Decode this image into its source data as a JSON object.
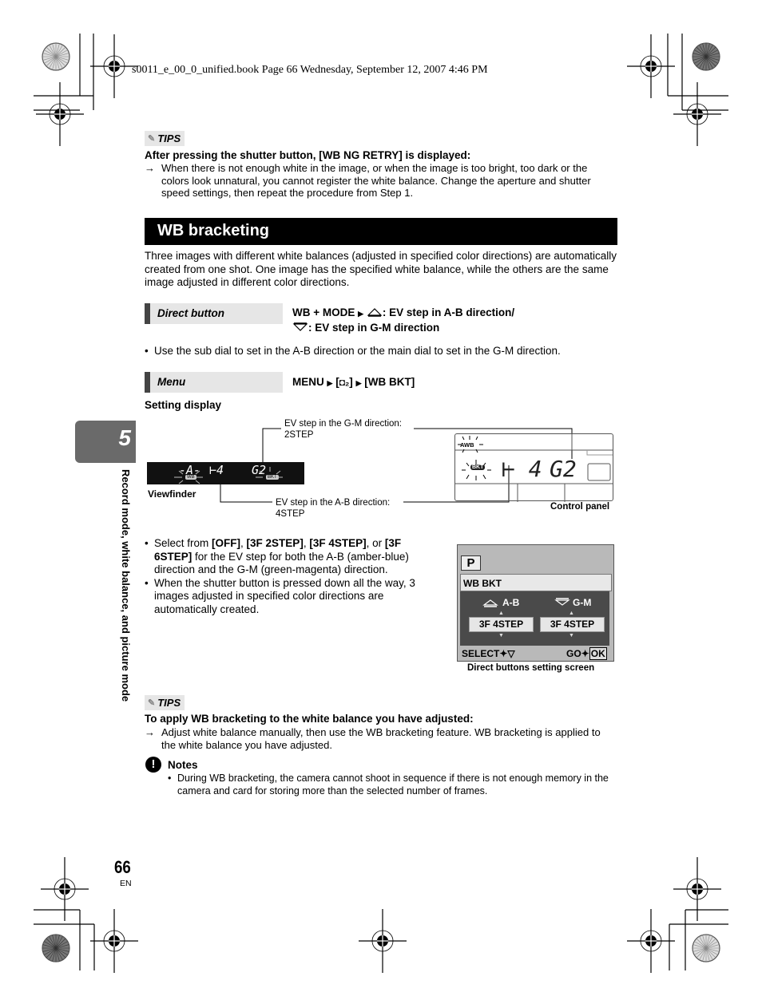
{
  "print_header": "s0011_e_00_0_unified.book  Page 66  Wednesday, September 12, 2007  4:46 PM",
  "tips1": {
    "badge": "TIPS",
    "icon": "memo-icon",
    "heading": "After pressing the shutter button, [WB NG RETRY] is displayed:",
    "arrow": "→",
    "text": "When there is not enough white in the image, or when the image is too bright, too dark or the colors look unnatural, you cannot register the white balance. Change the aperture and shutter speed settings, then repeat the procedure from Step 1."
  },
  "section": {
    "title": "WB bracketing",
    "intro": "Three images with different white balances (adjusted in specified color directions) are automatically created from one shot. One image has the specified white balance, while the others are the same image adjusted in different color directions."
  },
  "direct_button": {
    "label": "Direct button",
    "line1_prefix": "WB + MODE",
    "line1_rest": ": EV step in A-B direction/",
    "line2_rest": ": EV step in G-M direction",
    "tip": "Use the sub dial to set in the A-B direction or the main dial to set in the G-M direction."
  },
  "menu": {
    "label": "Menu",
    "path_a": "MENU",
    "path_b": "[",
    "path_b_icon": "camera2-icon",
    "path_b_end": "]",
    "path_c": "[WB BKT]"
  },
  "setting_display": {
    "heading": "Setting display",
    "callout_gm": "EV step in the G-M direction:",
    "callout_gm_value": "2STEP",
    "callout_ab": "EV step in the A-B direction:",
    "callout_ab_value": "4STEP",
    "viewfinder_label": "Viewfinder",
    "control_panel_label": "Control panel",
    "vf_wb": "-A-",
    "vf_ab": "⊢4",
    "vf_gm": "G2",
    "vf_wb_badge": "WB",
    "vf_bkt_badge": "BKT",
    "cp_awb": "AWB",
    "cp_bkt": "BKT",
    "cp_ab": "⊢ 4",
    "cp_gm": "G2"
  },
  "bullets": {
    "b1_pre": "Select from ",
    "b1_off": "[OFF]",
    "b1_c1": ", ",
    "b1_2": "[3F 2STEP]",
    "b1_c2": ", ",
    "b1_4": "[3F 4STEP]",
    "b1_or": ", or ",
    "b1_6": "[3F 6STEP]",
    "b1_post": " for the EV step for both the A-B (amber-blue) direction and the G-M (green-magenta) direction.",
    "b2": "When the shutter button is pressed down all the way, 3 images adjusted in specified color directions are automatically created."
  },
  "screen": {
    "mode": "P",
    "menu_title": "WB BKT",
    "ab_label": "A-B",
    "gm_label": "G-M",
    "ab_value": "3F 4STEP",
    "gm_value": "3F 4STEP",
    "select_label": "SELECT",
    "go_label": "GO",
    "ok_label": "OK",
    "caption": "Direct buttons setting screen"
  },
  "tips2": {
    "badge": "TIPS",
    "heading": "To apply WB bracketing to the white balance you have adjusted:",
    "arrow": "→",
    "text": "Adjust white balance manually, then use the WB bracketing feature. WB bracketing is applied to the white balance you have adjusted."
  },
  "notes": {
    "heading": "Notes",
    "item": "During WB bracketing, the camera cannot shoot in sequence if there is not enough memory in the camera and card for storing more than the selected number of frames."
  },
  "chapter": {
    "number": "5",
    "title": "Record mode, white balance, and picture mode"
  },
  "footer": {
    "page": "66",
    "lang": "EN"
  },
  "bullet_char": "•"
}
